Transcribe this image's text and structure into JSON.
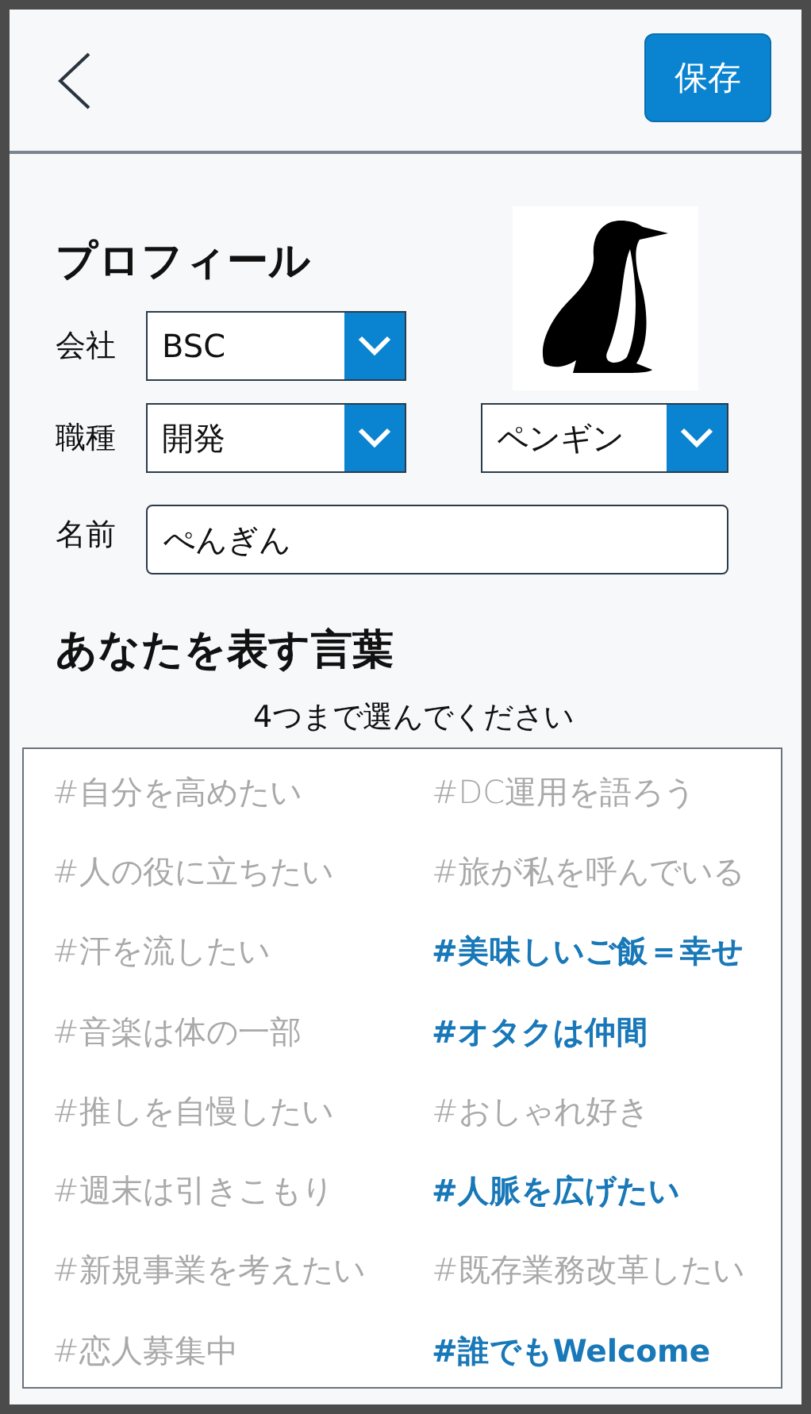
{
  "header": {
    "save_button": "保存"
  },
  "profile": {
    "title": "プロフィール",
    "company": {
      "label": "会社",
      "value": "BSC"
    },
    "job": {
      "label": "職種",
      "value": "開発"
    },
    "animal": {
      "value": "ペンギン"
    },
    "name": {
      "label": "名前",
      "value": "ぺんぎん"
    }
  },
  "words": {
    "title": "あなたを表す言葉",
    "hint": "4つまで選んでください",
    "tags": [
      {
        "label": "#自分を高めたい",
        "selected": false
      },
      {
        "label": "#DC運用を語ろう",
        "selected": false
      },
      {
        "label": "#人の役に立ちたい",
        "selected": false
      },
      {
        "label": "#旅が私を呼んでいる",
        "selected": false
      },
      {
        "label": "#汗を流したい",
        "selected": false
      },
      {
        "label": "#美味しいご飯＝幸せ",
        "selected": true
      },
      {
        "label": "#音楽は体の一部",
        "selected": false
      },
      {
        "label": "#オタクは仲間",
        "selected": true
      },
      {
        "label": "#推しを自慢したい",
        "selected": false
      },
      {
        "label": "#おしゃれ好き",
        "selected": false
      },
      {
        "label": "#週末は引きこもり",
        "selected": false
      },
      {
        "label": "#人脈を広げたい",
        "selected": true
      },
      {
        "label": "#新規事業を考えたい",
        "selected": false
      },
      {
        "label": "#既存業務改革したい",
        "selected": false
      },
      {
        "label": "#恋人募集中",
        "selected": false
      },
      {
        "label": "#誰でもWelcome",
        "selected": true
      }
    ]
  }
}
